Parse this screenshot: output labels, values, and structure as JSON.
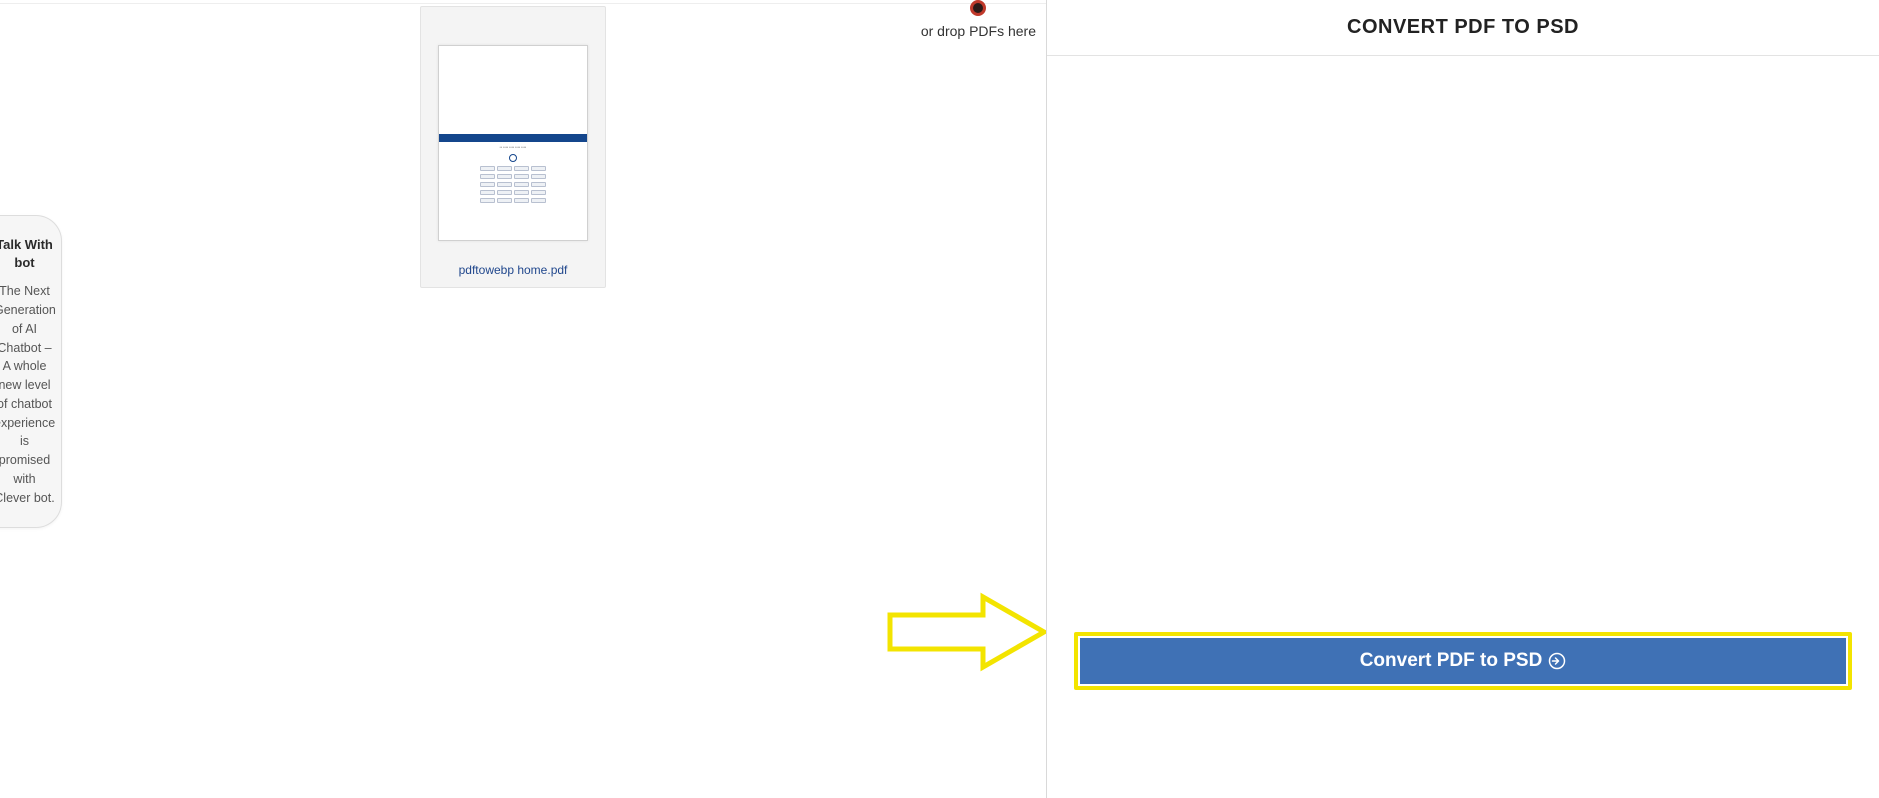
{
  "sidebar": {
    "title": "Talk With bot",
    "body": "The Next Generation of AI Chatbot – A whole new level of chatbot experience is promised with Clever bot."
  },
  "drop_hint": "or drop PDFs here",
  "file": {
    "name": "pdftowebp home.pdf"
  },
  "right": {
    "title": "CONVERT PDF TO PSD",
    "convert_label": "Convert PDF to PSD"
  }
}
